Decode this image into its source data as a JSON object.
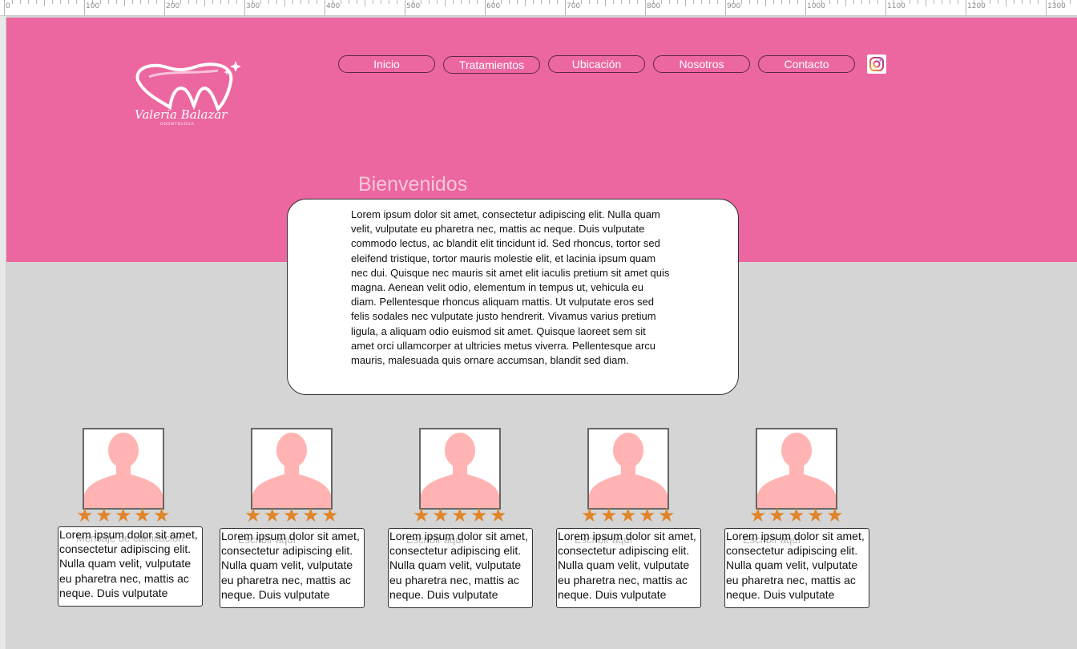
{
  "ruler": {
    "labels": [
      "0",
      "100",
      "200",
      "300",
      "400",
      "500",
      "600",
      "700",
      "800",
      "900",
      "1000",
      "1100",
      "1200",
      "1300"
    ]
  },
  "header": {
    "logo_name": "Valeria Balazar",
    "logo_sub": "ODONTOLOGA",
    "nav": [
      "Inicio",
      "Tratamientos",
      "Ubicación",
      "Nosotros",
      "Contacto"
    ],
    "social_icon": "instagram-icon",
    "brand_color": "#ec66a0"
  },
  "welcome": {
    "title": "Bienvenidos",
    "body": "Lorem ipsum dolor sit amet, consectetur adipiscing elit. Nulla quam velit, vulputate eu pharetra nec, mattis ac neque. Duis vulputate commodo lectus, ac blandit elit tincidunt id. Sed rhoncus, tortor sed eleifend tristique, tortor mauris molestie elit, et lacinia ipsum quam nec dui. Quisque nec mauris sit amet elit iaculis pretium sit amet quis magna. Aenean velit odio, elementum in tempus ut, vehicula eu diam. Pellentesque rhoncus aliquam mattis. Ut vulputate eros sed felis sodales nec vulputate justo hendrerit. Vivamus varius pretium ligula, a aliquam odio euismod sit amet. Quisque laoreet sem sit amet orci ullamcorper at ultricies metus viverra. Pellentesque arcu mauris, malesuada quis ornare accumsan, blandit sed diam."
  },
  "reviews": [
    {
      "rating": 5,
      "placeholder": "Mensaje de calificacion",
      "text": "Lorem ipsum dolor sit amet, consectetur adipiscing elit. Nulla quam velit, vulputate eu pharetra nec, mattis ac neque. Duis vulputate"
    },
    {
      "rating": 5,
      "placeholder": "Escribir aquí",
      "text": "Lorem ipsum dolor sit amet, consectetur adipiscing elit. Nulla quam velit, vulputate eu pharetra nec, mattis ac neque. Duis vulputate"
    },
    {
      "rating": 5,
      "placeholder": "Escribir aquí",
      "text": "Lorem ipsum dolor sit amet, consectetur adipiscing elit. Nulla quam velit, vulputate eu pharetra nec, mattis ac neque. Duis vulputate"
    },
    {
      "rating": 5,
      "placeholder": "Escribir aquí",
      "text": "Lorem ipsum dolor sit amet, consectetur adipiscing elit. Nulla quam velit, vulputate eu pharetra nec, mattis ac neque. Duis vulputate"
    },
    {
      "rating": 5,
      "placeholder": "Escribir aquí",
      "text": "Lorem ipsum dolor sit amet, consectetur adipiscing elit. Nulla quam velit, vulputate eu pharetra nec, mattis ac neque. Duis vulputate"
    }
  ],
  "colors": {
    "star": "#e0852a",
    "avatar": "#ffb3b3",
    "background": "#d5d5d5"
  }
}
